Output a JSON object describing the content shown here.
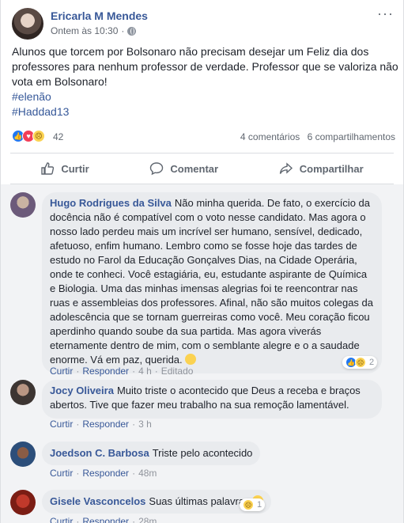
{
  "post": {
    "author": "Ericarla M Mendes",
    "time": "Ontem às 10:30",
    "time_sep": "·",
    "more": "···",
    "text": "Alunos que torcem por Bolsonaro não precisam desejar um Feliz dia dos professores para nenhum professor de verdade. Professor que se valoriza não vota em Bolsonaro!",
    "hashtags": [
      "#elenão",
      "#Haddad13"
    ],
    "reaction_count": "42",
    "comments_count": "4 comentários",
    "shares_count": "6 compartilhamentos"
  },
  "actions": {
    "like": "Curtir",
    "comment": "Comentar",
    "share": "Compartilhar"
  },
  "comments": [
    {
      "name": "Hugo Rodrigues da Silva",
      "text": "Não minha querida. De fato, o exercício da docência não é compatível com o voto nesse candidato. Mas agora o nosso lado perdeu mais um incrível ser humano, sensível, dedicado, afetuoso, enfim humano. Lembro como se fosse hoje das tardes de estudo no Farol da Educação Gonçalves Dias, na Cidade Operária, onde te conheci. Você estagiária, eu, estudante aspirante de Química e Biologia. Uma das minhas imensas alegrias foi te reencontrar nas ruas e assembleias dos professores. Afinal, não são muitos colegas da adolescência que se tornam guerreiras como você. Meu coração ficou aperdinho quando soube da sua partida. Mas agora viverás eternamente dentro de mim, com o semblante alegre e o a saudade enorme. Vá em paz, querida.",
      "like": "Curtir",
      "reply": "Responder",
      "time": "4 h",
      "edited": "Editado",
      "reactions": "2"
    },
    {
      "name": "Jocy Oliveira",
      "text": "Muito triste o acontecido que Deus a receba e braços abertos. Tive que fazer meu trabalho na sua remoção lamentável.",
      "like": "Curtir",
      "reply": "Responder",
      "time": "3 h"
    },
    {
      "name": "Joedson C. Barbosa",
      "text": "Triste pelo acontecido",
      "like": "Curtir",
      "reply": "Responder",
      "time": "48m"
    },
    {
      "name": "Gisele Vasconcelos",
      "text": "Suas últimas palavras",
      "like": "Curtir",
      "reply": "Responder",
      "time": "28m",
      "reactions": "1"
    }
  ],
  "colors": {
    "link": "#385898",
    "like": "#2078f4",
    "love": "#f33e58",
    "sad": "#fbd251"
  }
}
